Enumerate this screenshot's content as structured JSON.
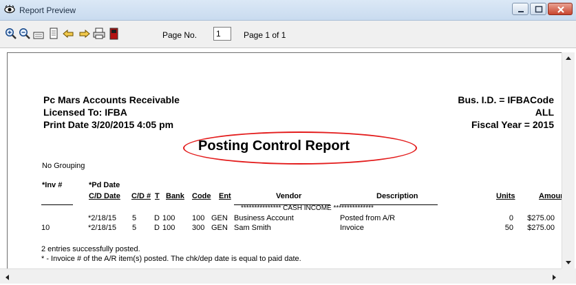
{
  "window": {
    "title": "Report Preview"
  },
  "toolbar": {
    "buttons": [
      "zoom-in",
      "zoom-out",
      "page-width",
      "whole-page",
      "previous-page",
      "next-page",
      "print",
      "close-report"
    ],
    "page_no_label": "Page No.",
    "page_no_value": "1",
    "page_count": "Page 1 of 1"
  },
  "report": {
    "company": "Pc Mars Accounts Receivable",
    "licensed": "Licensed To: IFBA",
    "print_date": "Print Date  3/20/2015 4:05 pm",
    "bus_id": "Bus. I.D. = IFBACode",
    "scope": "ALL",
    "fiscal_year": "Fiscal Year = 2015",
    "title": "Posting Control Report",
    "grouping": "No Grouping",
    "columns": {
      "inv": "*Inv #",
      "pd_date": "*Pd Date",
      "cd_date": "C/D Date",
      "cd_no": "C/D #",
      "t": "T",
      "bank": "Bank",
      "code": "Code",
      "ent": "Ent",
      "vendor": "Vendor",
      "description": "Description",
      "units": "Units",
      "amount": "Amount"
    },
    "section": "***************  CASH INCOME  ***************",
    "rows": [
      {
        "inv": "",
        "date": "*2/18/15",
        "cd": "5",
        "t": "D",
        "bank": "100",
        "code": "100",
        "ent": "GEN",
        "vendor": "Business Account",
        "description": "Posted from A/R",
        "units": "0",
        "amount": "$275.00"
      },
      {
        "inv": "10",
        "date": "*2/18/15",
        "cd": "5",
        "t": "D",
        "bank": "100",
        "code": "300",
        "ent": "GEN",
        "vendor": "Sam Smith",
        "description": "Invoice",
        "units": "50",
        "amount": "$275.00"
      }
    ],
    "footer_1": "2 entries successfully posted.",
    "footer_2": "*   - Invoice # of the A/R item(s) posted.  The chk/dep date is equal to paid date."
  },
  "colors": {
    "annotation_oval": "#e31b1b",
    "title_bar": "#c9dbef"
  }
}
